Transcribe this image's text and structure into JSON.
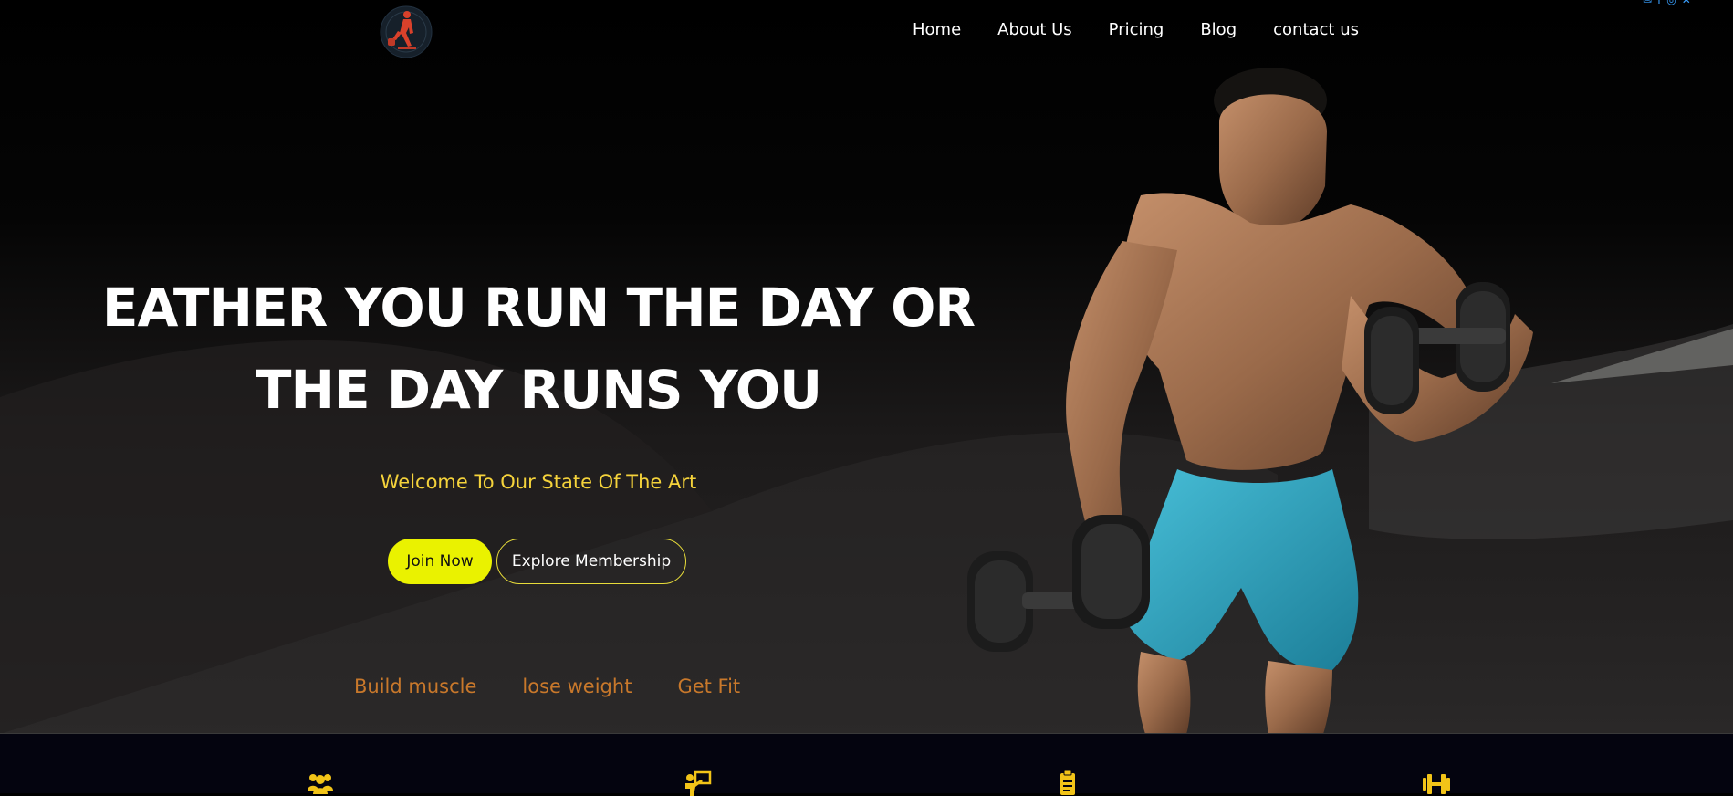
{
  "nav": {
    "items": [
      "Home",
      "About Us",
      "Pricing",
      "Blog",
      "contact us"
    ]
  },
  "socials": [
    "mail-icon",
    "facebook-icon",
    "instagram-icon",
    "x-icon"
  ],
  "hero": {
    "headline_line1": "EATHER YOU RUN THE DAY OR",
    "headline_line2": "THE DAY RUNS YOU",
    "tagline": "Welcome To Our State Of The Art",
    "join_label": "Join Now",
    "explore_label": "Explore Membership",
    "goals": [
      "Build muscle",
      "lose weight",
      "Get Fit"
    ]
  },
  "features": {
    "icons": [
      "group-icon",
      "trainer-icon",
      "clipboard-icon",
      "dumbbell-icon"
    ]
  },
  "colors": {
    "accent_yellow": "#eaf200",
    "tagline_gold": "#f5d33b",
    "goal_orange": "#c8782b",
    "feature_icon": "#f2c418",
    "shorts_blue": "#2fa3c0"
  }
}
